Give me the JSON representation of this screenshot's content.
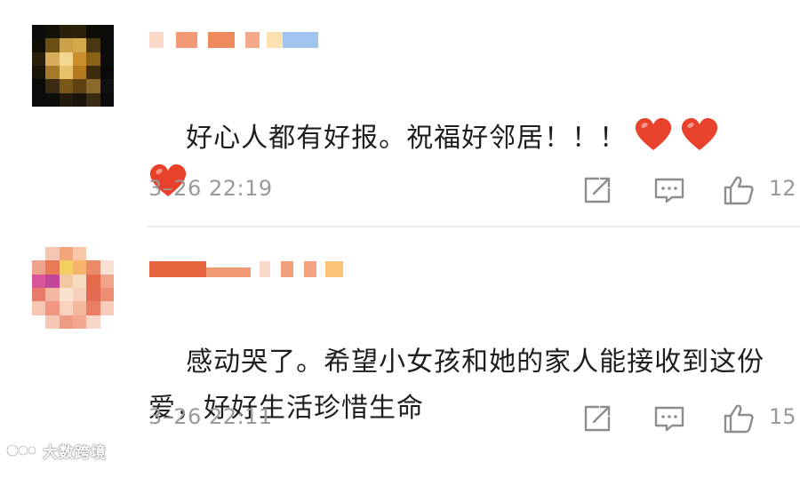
{
  "comments": [
    {
      "text": "好心人都有好报。祝福好邻居！！！",
      "reactions": [
        "heart-emoji",
        "heart-emoji",
        "heart-emoji"
      ],
      "timestamp": "3–26 22:19",
      "like_count": "12"
    },
    {
      "text": "感动哭了。希望小女孩和她的家人能接收到这份爱，好好生活珍惜生命",
      "reactions": [],
      "timestamp": "3–26 22:11",
      "like_count": "15"
    }
  ],
  "icons": {
    "share": "share-icon",
    "reply": "comment-icon",
    "like": "thumbs-up-icon",
    "heart": "red-heart-emoji"
  },
  "colors": {
    "meta_text": "#9a9a9a",
    "comment_text": "#1e1e1e",
    "heart": "#e8412c",
    "divider": "#ededed"
  },
  "watermark": {
    "text": "大数跨境"
  }
}
